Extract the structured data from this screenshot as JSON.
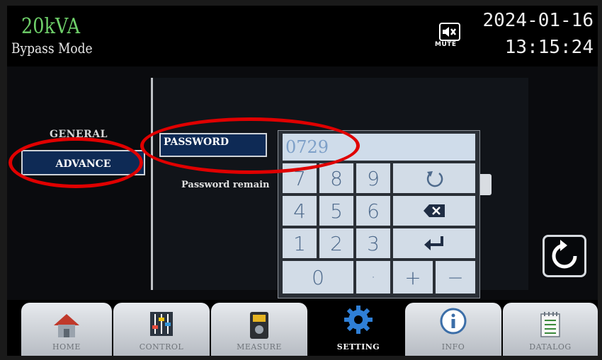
{
  "header": {
    "rating": "20kVA",
    "mode": "Bypass Mode",
    "mute_label": "MUTE",
    "date": "2024-01-16",
    "time": "13:15:24"
  },
  "menu": {
    "general_label": "GENERAL",
    "advance_label": "ADVANCE"
  },
  "settings": {
    "password_label": "PASSWORD",
    "password_remain_label": "Password remain"
  },
  "keypad": {
    "value": "0729",
    "row1": [
      "7",
      "8",
      "9"
    ],
    "row2": [
      "4",
      "5",
      "6"
    ],
    "row3": [
      "1",
      "2",
      "3"
    ],
    "row4": [
      "0",
      "·",
      "+",
      "−"
    ],
    "icons": {
      "reset": "undo-icon",
      "backspace": "backspace-icon",
      "enter": "enter-icon"
    }
  },
  "nav": {
    "home": "HOME",
    "control": "CONTROL",
    "measure": "MEASURE",
    "setting": "SETTING",
    "info": "INFO",
    "datalog": "DATALOG"
  },
  "colors": {
    "rating": "#6fd06a",
    "selected_bg": "#0e2a55",
    "key_bg": "#d2dce7",
    "annotation": "#e00000"
  }
}
